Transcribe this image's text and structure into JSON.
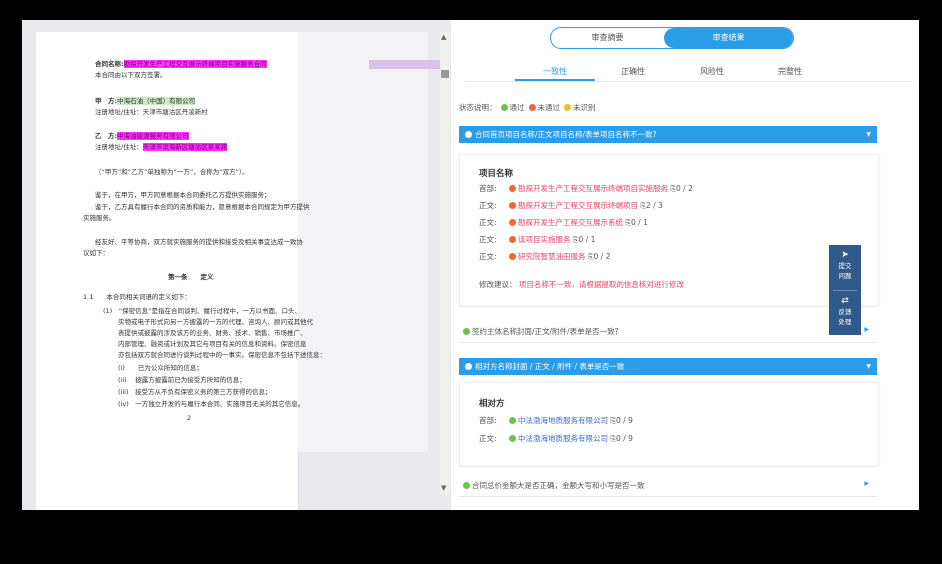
{
  "doc": {
    "contract_name_label": "合同名称:",
    "contract_name_value": "勘探开发生产工程交互展示终端项目实施服务合同",
    "intro": "本合同由以下双方签署。",
    "party_a_label": "甲　方:",
    "party_a_value": "中海石油（中国）有限公司",
    "party_a_addr": "注册地址/住址：天津市塘沽区丹凌新村",
    "party_b_label": "乙　方:",
    "party_b_value": "中海油能源服务有限公司",
    "party_b_addr_label": "注册地址/住址：",
    "party_b_addr_value": "天津市滨海新区塘沽区某某路",
    "collective": "（“甲方”和“乙方”单独称为“一方”，合称为“双方”）。",
    "whereas1": "鉴于，在甲方，甲方同意根据本合同委托乙方提供实施服务；",
    "whereas2": "鉴于，乙方具有履行本合同的资质和能力，愿意根据本合同规定为甲方提供",
    "whereas2b": "实施服务。",
    "agree1": "经友好、平等协商，双方就实施服务的提供和接受及相关事宜达成一致协",
    "agree2": "议如下：",
    "article": "第一条　　定义",
    "c11": "1.1　　本合同相关词语的定义如下：",
    "def1": "(1)　“保密信息”是指在合同谈判、履行过程中，一方以书面、口头、",
    "def2": "实物或电子形式向另一方披露的一方的代理、咨询人、顾问或其他代",
    "def3": "表提供或披露的涉及该方的业务、财务、技术、销售、市场推广、",
    "def4": "内部管理、融资或计划及其它与项目有关的信息和资料。保密信息",
    "def5": "亦包括双方就合同进行谈判过程中的一事实。保密信息不包括下述信息：",
    "i1": "(i)　　已为公众所知的信息；",
    "i2": "(ii)　 披露方披露前已为接受方所知的信息；",
    "i3": "(iii)　接受方从不负有保密义务的第三方获得的信息；",
    "i4": "(iv)　一方独立开发的与履行本合同、实施项目无关的其它信息。",
    "page_no": "2",
    "scroll_up": "▲",
    "scroll_down": "▼"
  },
  "review": {
    "toggle": [
      "审查摘要",
      "审查结果"
    ],
    "tabs": [
      "一致性",
      "正确性",
      "风险性",
      "完整性"
    ],
    "legend_label": "状态说明：",
    "legend": [
      "通过",
      "未通过",
      "未识别"
    ],
    "sections": [
      {
        "title": "合同首页项目名称/正文项目名称/表单项目名称不一致?",
        "card_title": "项目名称",
        "rows": [
          {
            "label": "首部:",
            "status": "fail",
            "value": "勘探开发生产工程交互展示终端项目实施服务",
            "count": "0 / 2"
          },
          {
            "label": "正文:",
            "status": "fail",
            "value": "勘探开发生产工程交互展示终端项目",
            "count": "2 / 3"
          },
          {
            "label": "正文:",
            "status": "fail",
            "value": "勘探开发生产工程交互展示系统",
            "count": "0 / 1"
          },
          {
            "label": "正文:",
            "status": "fail",
            "value": "该项目实施服务",
            "count": "0 / 1"
          },
          {
            "label": "正文:",
            "status": "fail",
            "value": "研究院智慧油田服务",
            "count": "0 / 2"
          }
        ],
        "suggestion_label": "修改建议：",
        "suggestion": "项目名称不一致，请根据提取的信息核对进行修改"
      },
      {
        "title": "签约主体名称封面/正文/附件/表单是否一致?"
      },
      {
        "title": "相对方名称封面 / 正文 / 附件 / 表单是否一致",
        "card_title": "相对方",
        "rows": [
          {
            "label": "首部:",
            "status": "pass",
            "value": "中法渤海地质服务有限公司",
            "count": "0 / 9"
          },
          {
            "label": "正文:",
            "status": "pass",
            "value": "中法渤海地质服务有限公司",
            "count": "0 / 9"
          }
        ]
      },
      {
        "title": "合同总价金额大是否正确，金额大写和小写是否一致"
      }
    ],
    "arrow_down": "▼",
    "arrow_right": "▶",
    "side_tools": [
      {
        "glyph": "➤",
        "label1": "提交",
        "label2": "问题"
      },
      {
        "glyph": "⇄",
        "label1": "反馈",
        "label2": "处理"
      }
    ]
  },
  "colors": {
    "accent": "#2b9ce8",
    "pass": "#6dc24b",
    "fail": "#f0683a",
    "unknown": "#f5b933",
    "fail_text": "#e2456a"
  }
}
